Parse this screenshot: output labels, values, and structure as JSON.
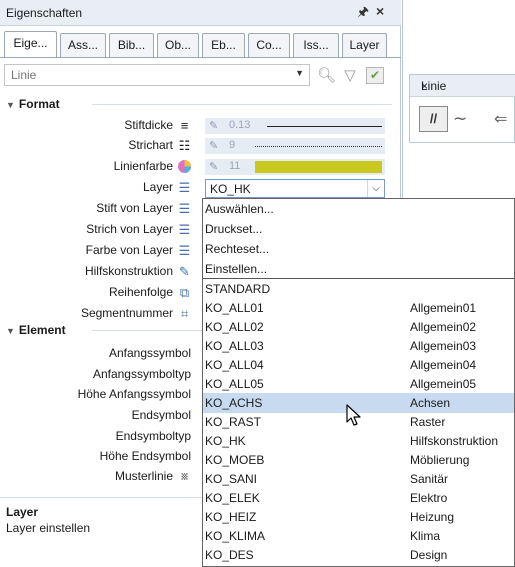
{
  "palette": {
    "title": "Eigenschaften",
    "pin_glyph": "Q",
    "close_glyph": "×",
    "tabs": [
      "Eige...",
      "Ass...",
      "Bib...",
      "Ob...",
      "Eb...",
      "Co...",
      "Iss...",
      "Layer"
    ],
    "active_tab": 0,
    "type_select": "Linie",
    "sections": {
      "format": "Format",
      "element": "Element"
    },
    "format_props": [
      {
        "label": "Stiftdicke",
        "icon": "line-weight-icon",
        "value": "0.13"
      },
      {
        "label": "Strichart",
        "icon": "line-type-icon",
        "value": "9"
      },
      {
        "label": "Linienfarbe",
        "icon": "color-wheel-icon",
        "value": "11"
      },
      {
        "label": "Layer",
        "icon": "layers-icon",
        "value": "KO_HK"
      },
      {
        "label": "Stift von Layer",
        "icon": "pen-from-layer-icon"
      },
      {
        "label": "Strich von Layer",
        "icon": "line-from-layer-icon"
      },
      {
        "label": "Farbe von Layer",
        "icon": "color-from-layer-icon"
      },
      {
        "label": "Hilfskonstruktion",
        "icon": "construction-icon"
      },
      {
        "label": "Reihenfolge",
        "icon": "order-icon"
      },
      {
        "label": "Segmentnummer",
        "icon": "segment-number-icon"
      }
    ],
    "element_props": [
      {
        "label": "Anfangssymbol"
      },
      {
        "label": "Anfangssymboltyp"
      },
      {
        "label": "Höhe Anfangssymbol"
      },
      {
        "label": "Endsymbol"
      },
      {
        "label": "Endsymboltyp"
      },
      {
        "label": "Höhe Endsymbol"
      },
      {
        "label": "Musterlinie",
        "icon": "pattern-line-icon"
      }
    ],
    "footer": {
      "title": "Layer",
      "description": "Layer einstellen"
    },
    "colors": {
      "accent": "#c8daf0",
      "line_color_swatch": "#c8c81e",
      "header_bg": "#e9eef5"
    }
  },
  "mini_palette": {
    "title": "Linie",
    "close_glyph": "×",
    "parallel_label": "//"
  },
  "dropdown": {
    "actions": [
      "Auswählen...",
      "Druckset...",
      "Rechteset...",
      "Einstellen..."
    ],
    "items": [
      {
        "name": "STANDARD",
        "desc": ""
      },
      {
        "name": "KO_ALL01",
        "desc": "Allgemein01"
      },
      {
        "name": "KO_ALL02",
        "desc": "Allgemein02"
      },
      {
        "name": "KO_ALL03",
        "desc": "Allgemein03"
      },
      {
        "name": "KO_ALL04",
        "desc": "Allgemein04"
      },
      {
        "name": "KO_ALL05",
        "desc": "Allgemein05"
      },
      {
        "name": "KO_ACHS",
        "desc": "Achsen"
      },
      {
        "name": "KO_RAST",
        "desc": "Raster"
      },
      {
        "name": "KO_HK",
        "desc": "Hilfskonstruktion"
      },
      {
        "name": "KO_MOEB",
        "desc": "Möblierung"
      },
      {
        "name": "KO_SANI",
        "desc": "Sanitär"
      },
      {
        "name": "KO_ELEK",
        "desc": "Elektro"
      },
      {
        "name": "KO_HEIZ",
        "desc": "Heizung"
      },
      {
        "name": "KO_KLIMA",
        "desc": "Klima"
      },
      {
        "name": "KO_DES",
        "desc": "Design"
      }
    ],
    "highlighted": "KO_ACHS"
  }
}
